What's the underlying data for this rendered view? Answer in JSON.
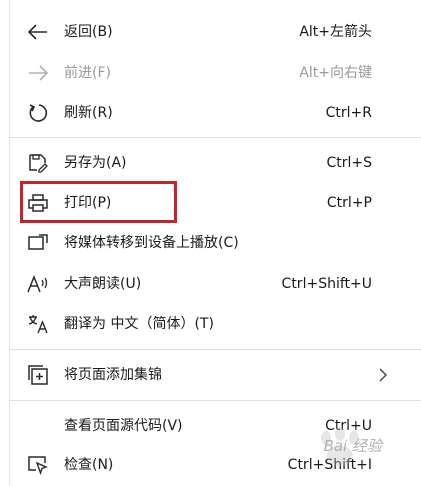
{
  "menu": {
    "items": [
      {
        "label": "返回(B)",
        "shortcut": "Alt+左箭头",
        "icon": "back-arrow-icon"
      },
      {
        "label": "前进(F)",
        "shortcut": "Alt+向右键",
        "icon": "forward-arrow-icon",
        "disabled": true
      },
      {
        "label": "刷新(R)",
        "shortcut": "Ctrl+R",
        "icon": "refresh-icon"
      },
      {
        "label": "另存为(A)",
        "shortcut": "Ctrl+S",
        "icon": "save-as-icon"
      },
      {
        "label": "打印(P)",
        "shortcut": "Ctrl+P",
        "icon": "printer-icon"
      },
      {
        "label": "将媒体转移到设备上播放(C)",
        "shortcut": "",
        "icon": "cast-icon"
      },
      {
        "label": "大声朗读(U)",
        "shortcut": "Ctrl+Shift+U",
        "icon": "read-aloud-icon"
      },
      {
        "label": "翻译为 中文（简体）(T)",
        "shortcut": "",
        "icon": "translate-icon"
      },
      {
        "label": "将页面添加集锦",
        "shortcut": "",
        "icon": "add-to-collections-icon"
      },
      {
        "label": "查看页面源代码(V)",
        "shortcut": "Ctrl+U",
        "icon": ""
      },
      {
        "label": "检查(N)",
        "shortcut": "Ctrl+Shift+I",
        "icon": "inspect-icon"
      }
    ]
  },
  "colors": {
    "highlight_border": "#c8232b",
    "disabled_text": "#9a9a9a"
  },
  "watermark": {
    "text": "Bai 经验"
  }
}
